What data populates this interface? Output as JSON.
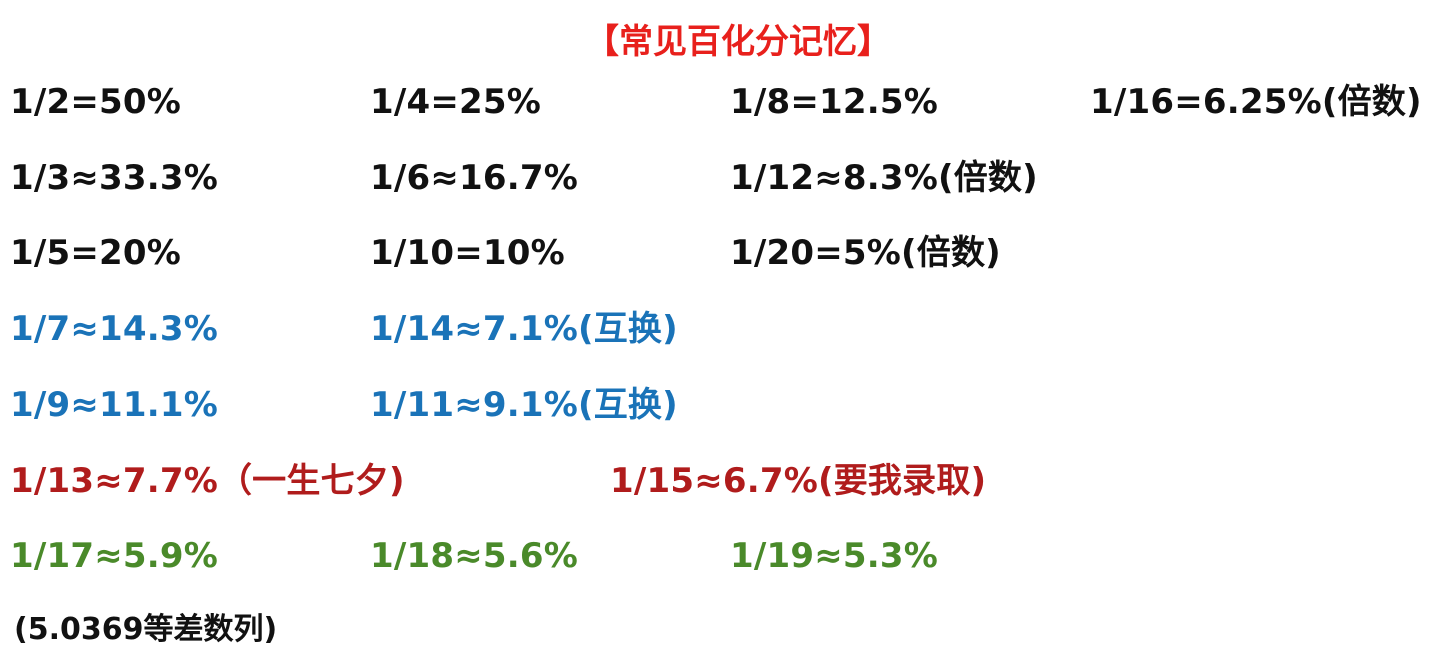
{
  "title": "【常见百化分记忆】",
  "rows": [
    {
      "cells": [
        "1/2=50%",
        "1/4=25%",
        "1/8=12.5%",
        "1/16=6.25%(倍数)"
      ]
    },
    {
      "cells": [
        "1/3≈33.3%",
        "1/6≈16.7%",
        "1/12≈8.3%(倍数)"
      ]
    },
    {
      "cells": [
        "1/5=20%",
        "1/10=10%",
        "1/20=5%(倍数)"
      ]
    },
    {
      "cells": [
        "1/7≈14.3%",
        "1/14≈7.1%(互换)"
      ]
    },
    {
      "cells": [
        "1/9≈11.1%",
        "1/11≈9.1%(互换)"
      ]
    },
    {
      "cells": [
        "1/13≈7.7%（一生七夕)",
        "1/15≈6.7%(要我录取)"
      ]
    },
    {
      "cells": [
        "1/17≈5.9%",
        "1/18≈5.6%",
        "1/19≈5.3%"
      ]
    }
  ],
  "note": "(5.0369等差数列)",
  "colors": {
    "title": "#e8201c",
    "black": "#111111",
    "blue": "#1a73b8",
    "red": "#b01c1c",
    "green": "#4a8a2a"
  }
}
